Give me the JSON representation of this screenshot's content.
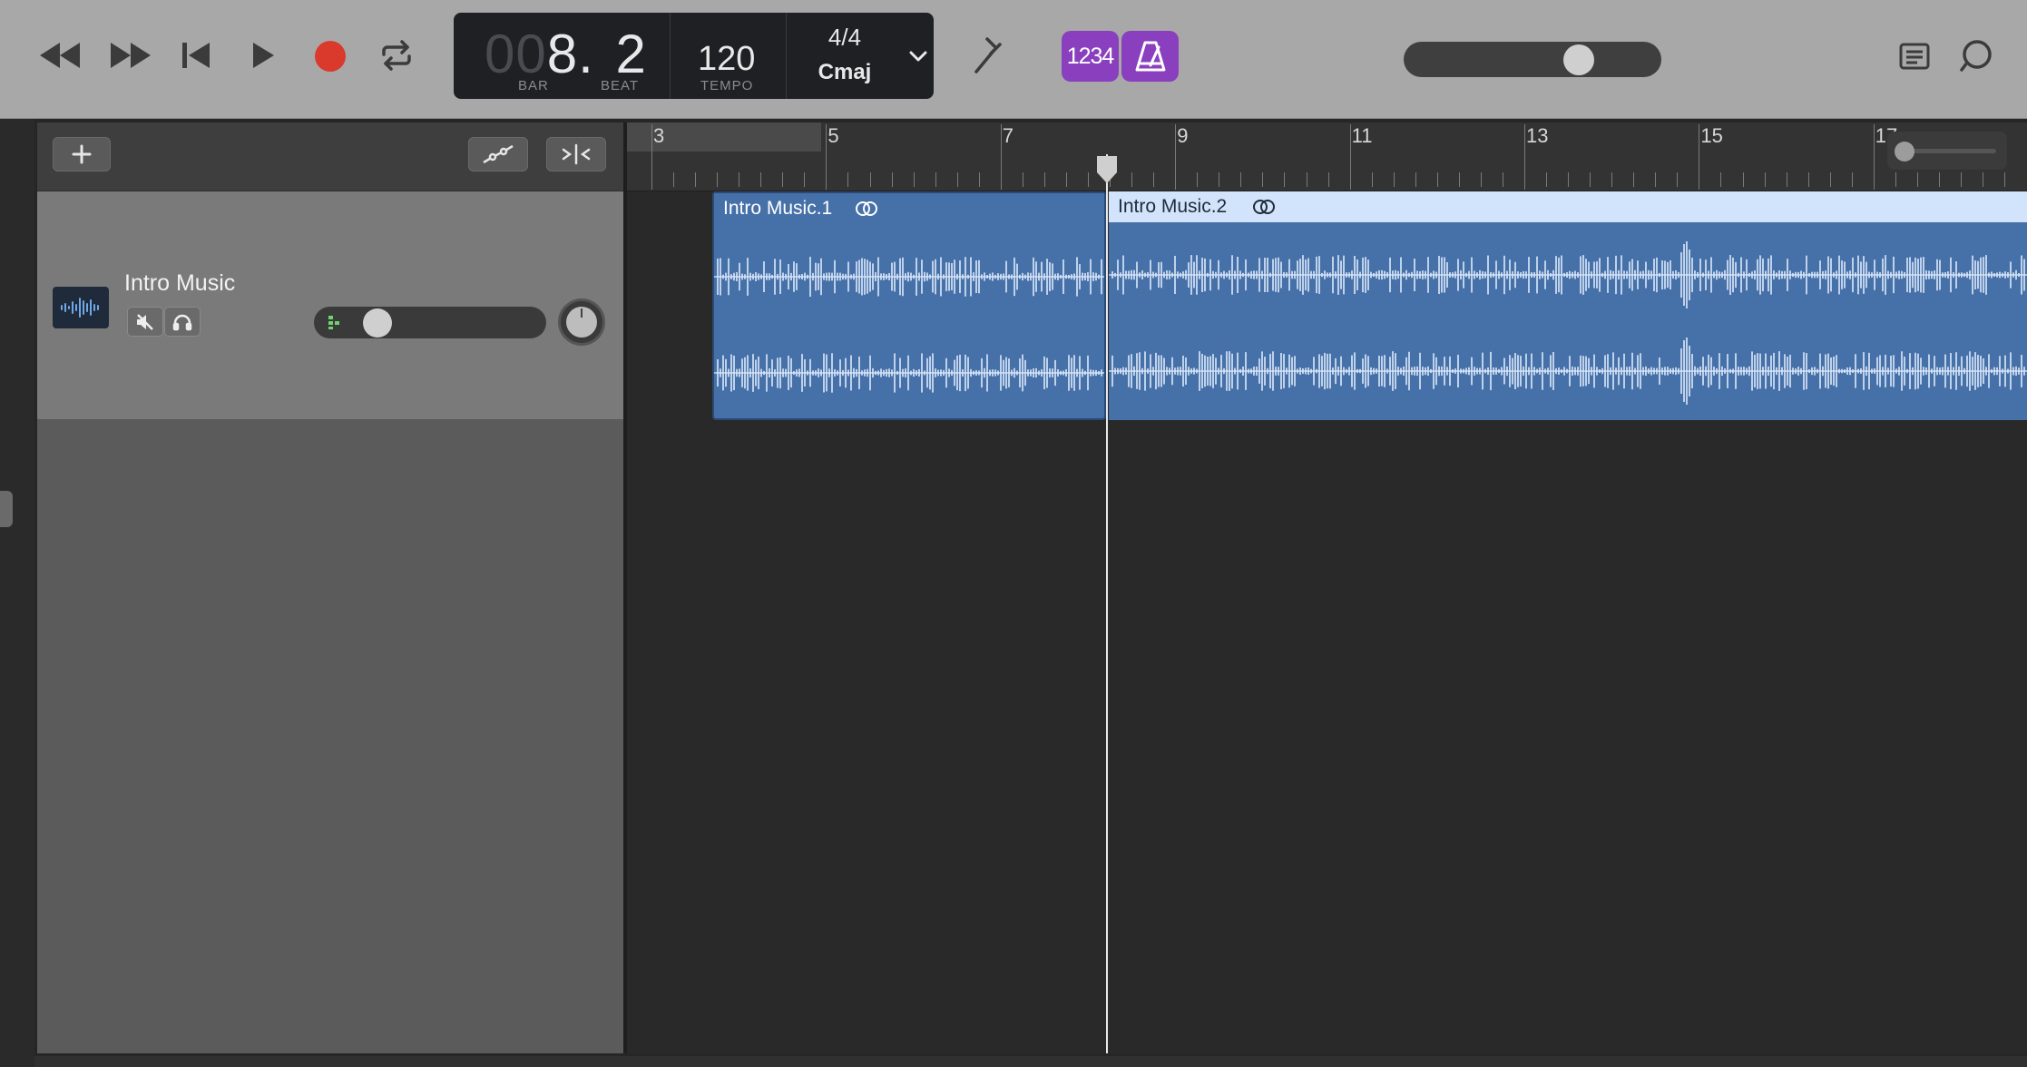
{
  "lcd": {
    "bar_dim": "00",
    "bar_value": "8.",
    "beat_value": "2",
    "bar_label": "BAR",
    "beat_label": "BEAT",
    "tempo_value": "120",
    "tempo_label": "TEMPO",
    "time_signature": "4/4",
    "key": "Cmaj"
  },
  "count_in_label": "1234",
  "track": {
    "name": "Intro Music",
    "volume_fraction": 0.22
  },
  "ruler": {
    "bars": [
      "3",
      "5",
      "7",
      "9",
      "11",
      "13",
      "15",
      "17"
    ]
  },
  "regions": [
    {
      "name": "Intro Music.1",
      "selected": false
    },
    {
      "name": "Intro Music.2",
      "selected": true
    }
  ],
  "master_volume_fraction": 0.62,
  "colors": {
    "record": "#d93a2b",
    "accent_purple": "#8a3fbf",
    "region_blue": "#4670a8",
    "selection_blue": "#7fb3e6"
  }
}
